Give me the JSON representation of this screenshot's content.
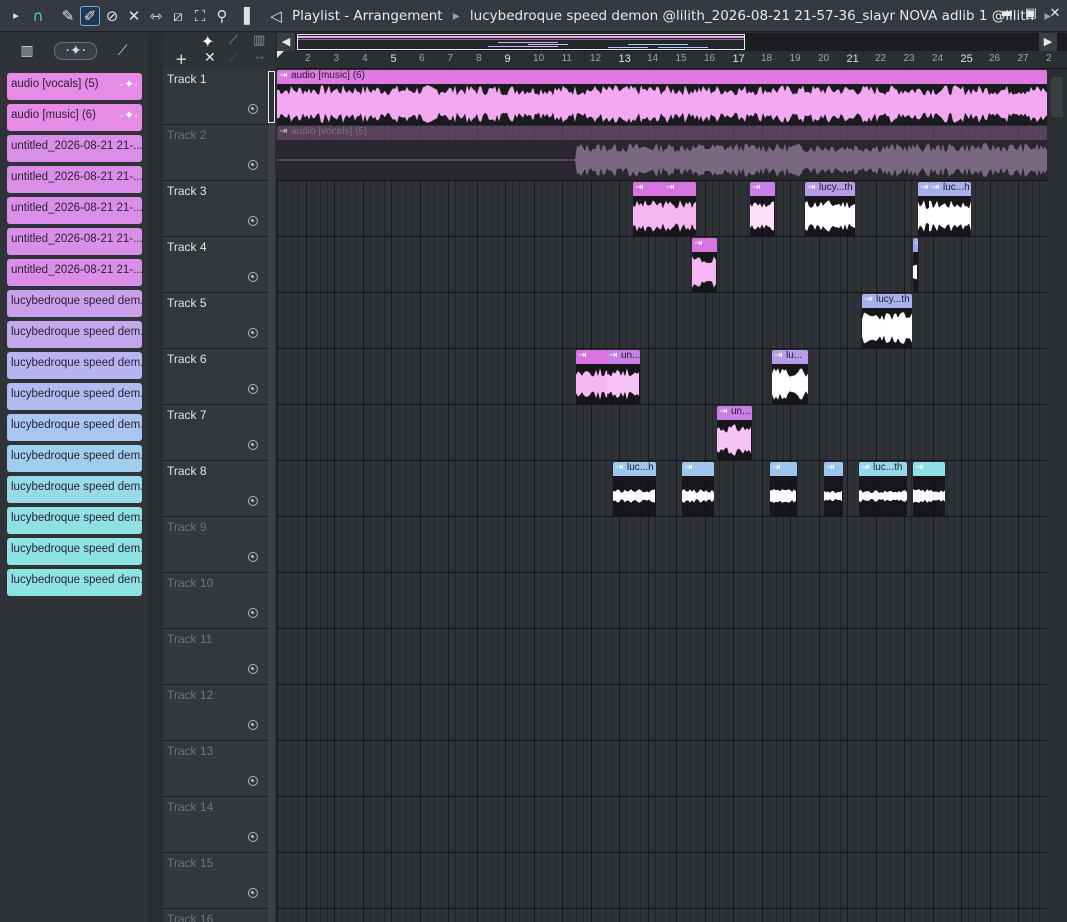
{
  "window": {
    "title_prefix": "Playlist - Arrangement",
    "title_pattern": "lucybedroque speed demon @lilith_2026-08-21 21-57-36_slayr NOVA adlib 1 @lilith"
  },
  "browser": {
    "clips": [
      {
        "label": "audio [vocals] (5)",
        "color": "#e68be6"
      },
      {
        "label": "audio [music] (6)",
        "color": "#e68be6"
      },
      {
        "label": "untitled_2026-08-21 21-...",
        "color": "#d98fe8"
      },
      {
        "label": "untitled_2026-08-21 21-...",
        "color": "#d98fe8"
      },
      {
        "label": "untitled_2026-08-21 21-...",
        "color": "#d98fe8"
      },
      {
        "label": "untitled_2026-08-21 21-...",
        "color": "#d98fe8"
      },
      {
        "label": "untitled_2026-08-21 21-...",
        "color": "#d98fe8"
      },
      {
        "label": "lucybedroque speed dem...",
        "color": "#c9a0ea"
      },
      {
        "label": "lucybedroque speed dem...",
        "color": "#c3a8ec"
      },
      {
        "label": "lucybedroque speed dem...",
        "color": "#b9b4ef"
      },
      {
        "label": "lucybedroque speed dem...",
        "color": "#b0bcef"
      },
      {
        "label": "lucybedroque speed dem...",
        "color": "#a8c6ef"
      },
      {
        "label": "lucybedroque speed dem...",
        "color": "#a0cfee"
      },
      {
        "label": "lucybedroque speed dem...",
        "color": "#98dbe8"
      },
      {
        "label": "lucybedroque speed dem...",
        "color": "#90e1e4"
      },
      {
        "label": "lucybedroque speed dem...",
        "color": "#8ee3e3"
      },
      {
        "label": "lucybedroque speed dem...",
        "color": "#8ee3e3"
      }
    ]
  },
  "ruler": {
    "bars": [
      "2",
      "3",
      "4",
      "5",
      "6",
      "7",
      "8",
      "9",
      "10",
      "11",
      "12",
      "13",
      "14",
      "15",
      "16",
      "17",
      "18",
      "19",
      "20",
      "21",
      "22",
      "23",
      "24",
      "25",
      "26",
      "27",
      "2"
    ]
  },
  "tracks": [
    {
      "name": "Track 1",
      "muted": false
    },
    {
      "name": "Track 2",
      "muted": true
    },
    {
      "name": "Track 3",
      "muted": false
    },
    {
      "name": "Track 4",
      "muted": false
    },
    {
      "name": "Track 5",
      "muted": false
    },
    {
      "name": "Track 6",
      "muted": false
    },
    {
      "name": "Track 7",
      "muted": false
    },
    {
      "name": "Track 8",
      "muted": false
    },
    {
      "name": "Track 9",
      "muted": false
    },
    {
      "name": "Track 10",
      "muted": false
    },
    {
      "name": "Track 11",
      "muted": false
    },
    {
      "name": "Track 12",
      "muted": false
    },
    {
      "name": "Track 13",
      "muted": false
    },
    {
      "name": "Track 14",
      "muted": false
    },
    {
      "name": "Track 15",
      "muted": false
    },
    {
      "name": "Track 16",
      "muted": false
    }
  ],
  "playlist": {
    "track1_clip": "audio [music] (6)",
    "track2_clip": "audio [vocals] (5)",
    "clip_labels": [
      "lucy...th",
      "luc...h",
      "un...",
      "lucy...th",
      "lu...",
      "un...",
      "luc...h",
      "luc...th"
    ]
  },
  "colors": {
    "pink": "#f0a6f0",
    "purple": "#c89ae8",
    "lavender": "#aeb2ee",
    "blue": "#9cc6ec",
    "cyan": "#8fe0e6"
  }
}
